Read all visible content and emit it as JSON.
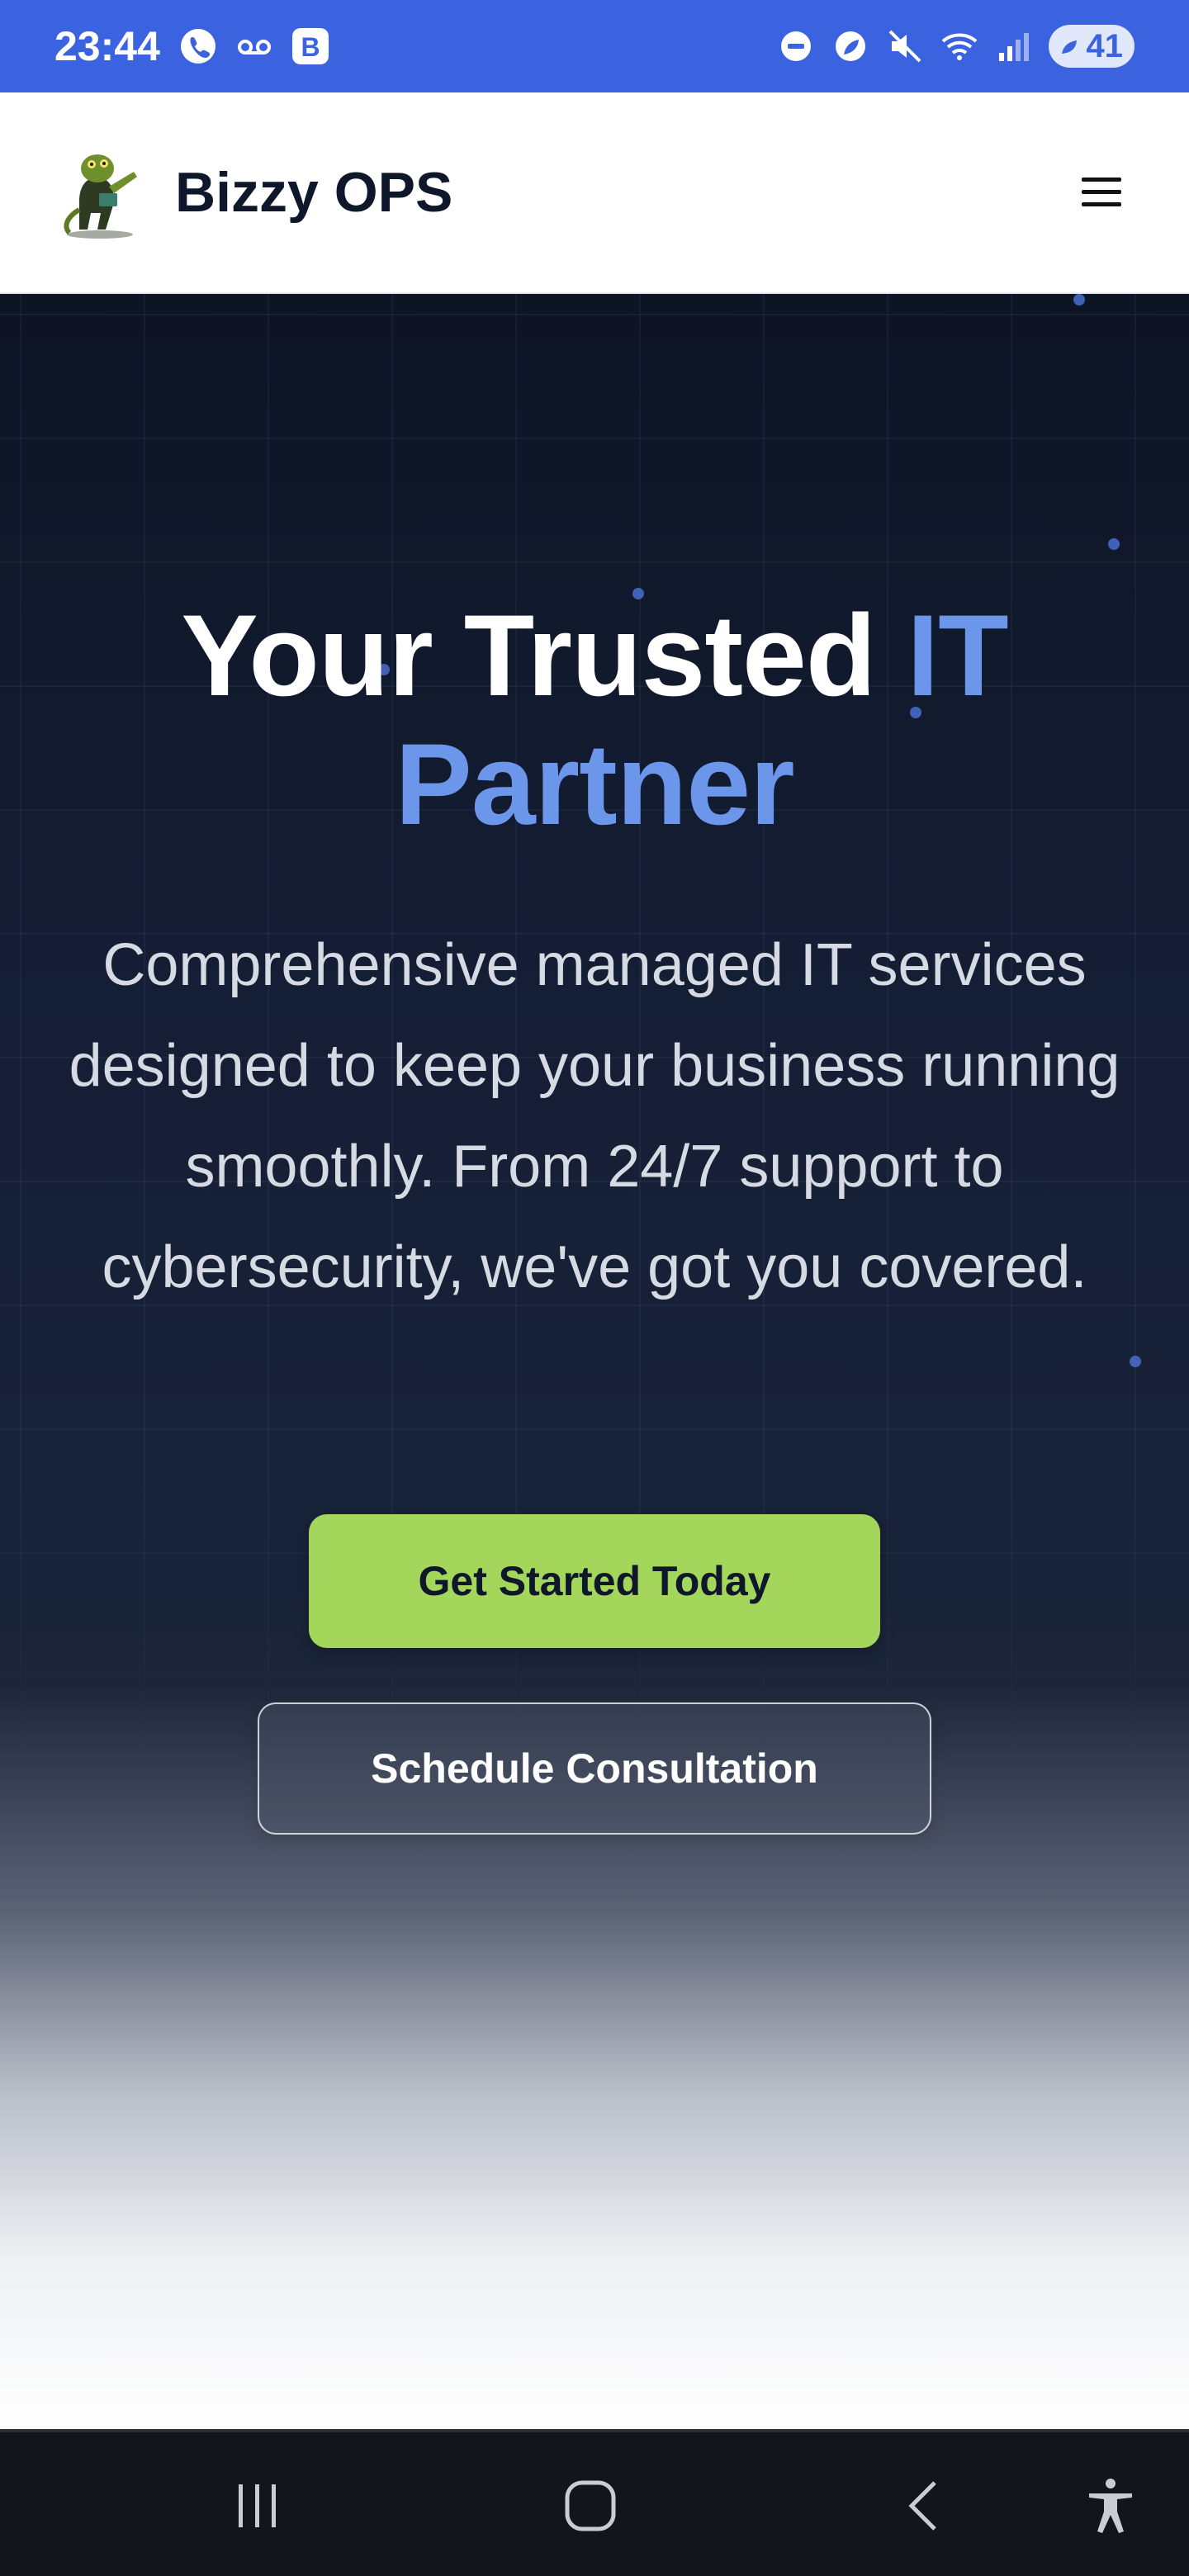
{
  "status_bar": {
    "time": "23:44",
    "battery_level": "41",
    "left_icons": [
      "phone-call-icon",
      "voicemail-icon",
      "b-app-icon"
    ],
    "right_icons": [
      "do-not-disturb-icon",
      "leaf-icon",
      "mute-icon",
      "wifi-icon",
      "signal-icon",
      "battery-icon"
    ]
  },
  "header": {
    "brand": "Bizzy OPS",
    "logo_icon": "gecko-logo-icon",
    "menu_icon": "hamburger-menu-icon"
  },
  "hero": {
    "title_part1": "Your Trusted ",
    "title_accent_1": "IT",
    "title_accent_2": "Partner",
    "subtitle": "Comprehensive managed IT services designed to keep your business running smoothly. From 24/7 support to cybersecurity, we've got you covered.",
    "primary_cta": "Get Started Today",
    "secondary_cta": "Schedule Consultation",
    "colors": {
      "accent": "#6b96ea",
      "primary_button": "#a3d65a",
      "background_dark": "#0d1424"
    }
  },
  "nav_bar": {
    "buttons": [
      "recent-apps-icon",
      "home-icon",
      "back-icon",
      "accessibility-icon"
    ]
  }
}
